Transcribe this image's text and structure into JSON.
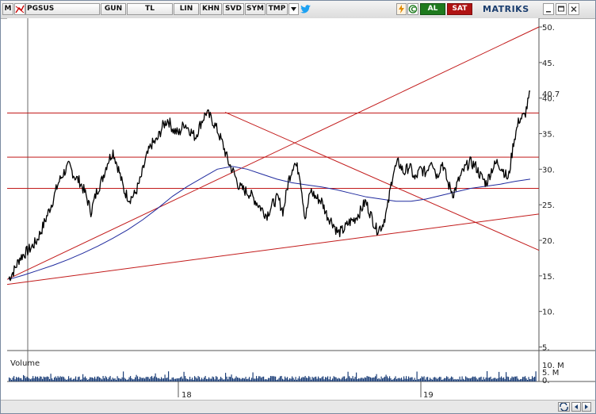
{
  "toolbar": {
    "m_label": "M",
    "symbol": "PGSUS",
    "period": "GUN",
    "currency": "TL",
    "scale_btn": "LIN",
    "khn_btn": "KHN",
    "svd_btn": "SVD",
    "sym_btn": "SYM",
    "tmp_btn": "TMP",
    "buy_label": "AL",
    "sell_label": "SAT",
    "brand": "MATRIKS"
  },
  "icons": [
    "chart-icon",
    "dropdown-icon",
    "twitter-icon",
    "flash-icon",
    "c-icon",
    "minimize-icon",
    "maximize-icon",
    "close-icon",
    "refresh-icon",
    "scroll-left-icon",
    "scroll-right-icon"
  ],
  "colors": {
    "price": "#000000",
    "moving_average": "#1f2a9e",
    "trend_lines": "#c21a1a",
    "volume": "#1c3f78",
    "buy": "#1e7a1e",
    "sell": "#b01313"
  },
  "chart_data": {
    "type": "line",
    "title": "",
    "xlabel": "",
    "ylabel": "",
    "x_ticks": [
      "18",
      "19"
    ],
    "y_ticks": [
      5,
      10,
      15,
      20,
      25,
      30,
      35,
      40,
      45,
      50
    ],
    "ylim": [
      5,
      51
    ],
    "last_price_label": "40.7",
    "series": [],
    "price_path": [
      14.6,
      15.8,
      17.5,
      18.2,
      18.9,
      19.8,
      21.5,
      23.5,
      25.5,
      28.0,
      29.5,
      30.5,
      29.0,
      28.2,
      26.5,
      24.0,
      26.8,
      28.5,
      31.0,
      32.5,
      30.0,
      27.0,
      25.8,
      26.5,
      28.5,
      31.5,
      33.5,
      34.0,
      36.0,
      37.0,
      35.5,
      35.0,
      36.5,
      35.5,
      34.5,
      36.5,
      38.0,
      37.0,
      35.5,
      33.5,
      31.0,
      29.5,
      27.5,
      27.0,
      26.5,
      25.5,
      24.5,
      23.5,
      25.0,
      26.0,
      24.0,
      28.5,
      31.0,
      29.5,
      23.0,
      27.0,
      26.0,
      25.5,
      23.5,
      22.5,
      21.0,
      21.5,
      22.5,
      23.0,
      24.0,
      25.5,
      23.5,
      21.5,
      22.0,
      24.5,
      29.5,
      31.0,
      29.5,
      30.5,
      28.5,
      30.0,
      29.5,
      31.5,
      29.0,
      31.0,
      28.0,
      26.5,
      28.5,
      30.0,
      31.0,
      30.5,
      29.0,
      28.0,
      30.0,
      31.0,
      30.0,
      28.5,
      34.0,
      37.0,
      37.5,
      40.7
    ],
    "ma_path": [
      14.5,
      15.1,
      15.8,
      16.5,
      17.3,
      18.2,
      19.2,
      20.3,
      21.5,
      22.9,
      24.5,
      26.2,
      27.6,
      28.8,
      30.0,
      30.4,
      30.0,
      29.3,
      28.6,
      28.1,
      27.8,
      27.5,
      27.1,
      26.6,
      26.1,
      25.8,
      25.5,
      25.5,
      25.8,
      26.3,
      26.8,
      27.3,
      27.6,
      27.9,
      28.3,
      28.6
    ],
    "trend_lines": [
      {
        "kind": "horizontal",
        "y": 37.9
      },
      {
        "kind": "horizontal",
        "y": 31.7
      },
      {
        "kind": "horizontal",
        "y": 27.3
      },
      {
        "kind": "line",
        "from": [
          0.0,
          14.5
        ],
        "to": [
          1.0,
          50.0
        ]
      },
      {
        "kind": "line",
        "from": [
          0.0,
          13.8
        ],
        "to": [
          1.0,
          23.7
        ]
      },
      {
        "kind": "line",
        "from": [
          0.41,
          38.0
        ],
        "to": [
          1.0,
          18.6
        ]
      }
    ],
    "volume": {
      "label": "Volume",
      "ticks": [
        "10. M",
        "5. M",
        "0."
      ]
    }
  }
}
